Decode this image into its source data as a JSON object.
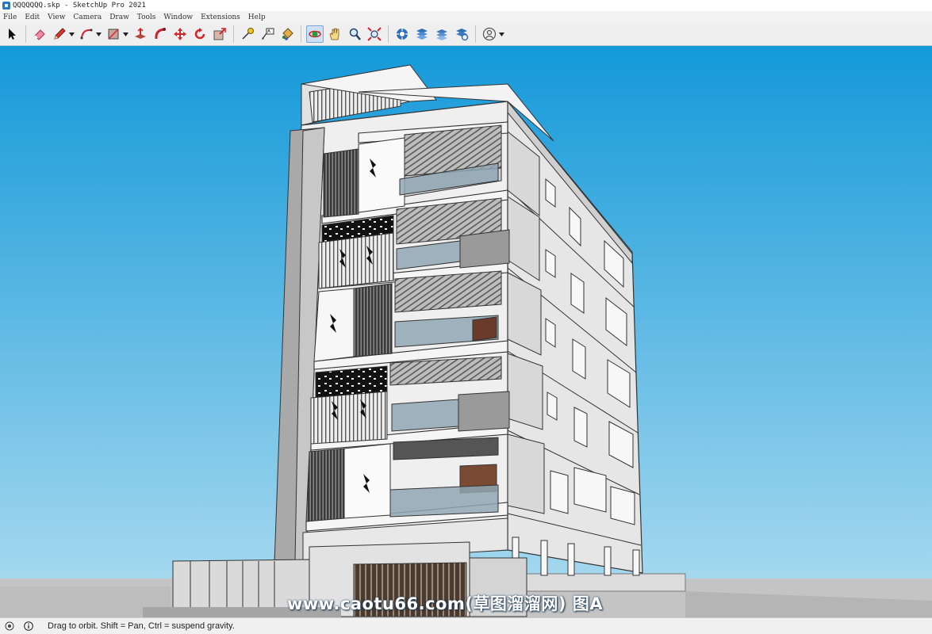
{
  "window": {
    "title": "QQQQQQQ.skp - SketchUp Pro 2021"
  },
  "menu": [
    "File",
    "Edit",
    "View",
    "Camera",
    "Draw",
    "Tools",
    "Window",
    "Extensions",
    "Help"
  ],
  "toolbar": {
    "tools": [
      {
        "name": "select-tool",
        "icon": "arrow-cursor-icon"
      },
      {
        "name": "eraser-tool",
        "icon": "eraser-icon"
      },
      {
        "name": "line-tool",
        "icon": "pencil-icon",
        "dropdown": true
      },
      {
        "name": "arc-tool",
        "icon": "arc-icon",
        "dropdown": true
      },
      {
        "name": "rectangle-tool",
        "icon": "rectangle-icon",
        "dropdown": true
      },
      {
        "name": "push-pull-tool",
        "icon": "push-pull-icon"
      },
      {
        "name": "follow-me-tool",
        "icon": "follow-me-icon"
      },
      {
        "name": "move-tool",
        "icon": "move-icon"
      },
      {
        "name": "rotate-tool",
        "icon": "rotate-icon"
      },
      {
        "name": "scale-tool",
        "icon": "scale-icon"
      },
      {
        "name": "tape-measure-tool",
        "icon": "tape-measure-icon"
      },
      {
        "name": "text-tool",
        "icon": "text-icon"
      },
      {
        "name": "paint-bucket-tool",
        "icon": "paint-bucket-icon"
      },
      {
        "name": "orbit-tool",
        "icon": "orbit-icon",
        "active": true
      },
      {
        "name": "pan-tool",
        "icon": "hand-icon"
      },
      {
        "name": "zoom-tool",
        "icon": "magnifier-icon"
      },
      {
        "name": "zoom-extents-tool",
        "icon": "zoom-extents-icon"
      },
      {
        "name": "warehouse-tool",
        "icon": "warehouse-icon"
      },
      {
        "name": "extension-warehouse-tool",
        "icon": "extension-warehouse-icon"
      },
      {
        "name": "layout-tool",
        "icon": "layout-icon"
      },
      {
        "name": "extension-manager-tool",
        "icon": "extension-manager-icon"
      },
      {
        "name": "account-tool",
        "icon": "account-icon",
        "dropdown": true
      }
    ]
  },
  "viewport": {
    "sky_top": "#1499d9",
    "sky_bottom": "#aedcf0",
    "ground": "#c4c4c4"
  },
  "watermark": "www.caotu66.com(草图溜溜网) 图A",
  "status": {
    "info_icon": "info-icon",
    "text": "Drag to orbit. Shift = Pan, Ctrl = suspend gravity."
  }
}
